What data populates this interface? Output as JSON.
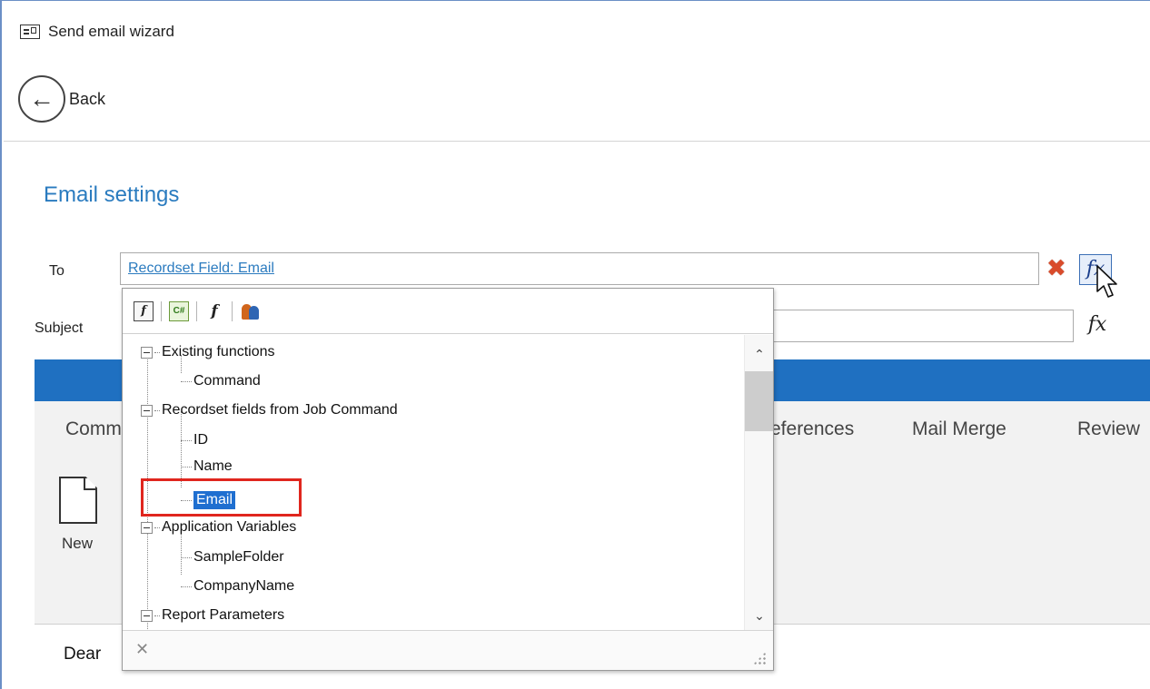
{
  "window": {
    "title": "Send email wizard"
  },
  "nav": {
    "back_label": "Back"
  },
  "section": {
    "title": "Email settings"
  },
  "fields": {
    "to_label": "To",
    "to_value": "Recordset Field: Email",
    "subject_label": "Subject",
    "subject_value": ""
  },
  "ribbon": {
    "tabs": [
      "Comm",
      "eferences",
      "Mail Merge",
      "Review"
    ],
    "new_label": "New"
  },
  "editor": {
    "text": "Dear"
  },
  "popup": {
    "toolbar_icons": [
      "function-icon",
      "csharp-script-icon",
      "function-builder-icon",
      "users-icon"
    ],
    "tree": [
      {
        "label": "Existing functions",
        "level": 0,
        "expanded": true
      },
      {
        "label": "Command",
        "level": 1
      },
      {
        "label": "Recordset fields from Job Command",
        "level": 0,
        "expanded": true
      },
      {
        "label": "ID",
        "level": 1
      },
      {
        "label": "Name",
        "level": 1
      },
      {
        "label": "Email",
        "level": 1,
        "selected": true
      },
      {
        "label": "Application Variables",
        "level": 0,
        "expanded": true
      },
      {
        "label": "SampleFolder",
        "level": 1
      },
      {
        "label": "CompanyName",
        "level": 1
      },
      {
        "label": "Report Parameters",
        "level": 0,
        "expanded": true
      }
    ]
  },
  "colors": {
    "accent": "#2a7bbf",
    "ribbon_band": "#1f70c1",
    "selection": "#1f6fd0",
    "highlight_border": "#e0261e"
  }
}
